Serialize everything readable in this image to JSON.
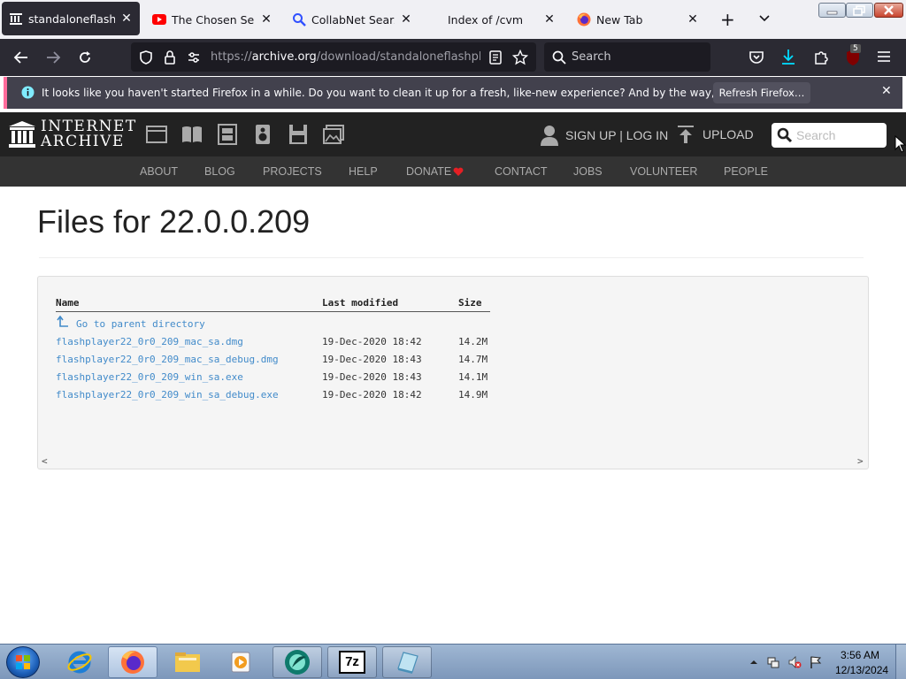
{
  "browser": {
    "tabs": [
      {
        "title": "standaloneflashpla",
        "icon": "internet-archive-favicon",
        "active": true
      },
      {
        "title": "The Chosen Season",
        "icon": "youtube-favicon",
        "active": false
      },
      {
        "title": "CollabNet SearXNG",
        "icon": "searxng-favicon",
        "active": false
      },
      {
        "title": "Index of /cvm",
        "icon": "none",
        "active": false
      },
      {
        "title": "New Tab",
        "icon": "firefox-favicon",
        "active": false
      }
    ],
    "new_tab_label": "+",
    "url_prefix": "https://",
    "url_domain": "archive.org",
    "url_path": "/download/standaloneflashplayer",
    "search_placeholder": "Search",
    "extension_badge": "5"
  },
  "notification": {
    "message": "It looks like you haven't started Firefox in a while. Do you want to clean it up for a fresh, like-new experience? And by the way, welcome back!",
    "button_label": "Refresh Firefox…",
    "close_glyph": "✕"
  },
  "ia_header": {
    "logo_line1": "INTERNET",
    "logo_line2": "ARCHIVE",
    "signup_login": "SIGN UP | LOG IN",
    "upload": "UPLOAD",
    "search_placeholder": "Search"
  },
  "ia_subnav": [
    "ABOUT",
    "BLOG",
    "PROJECTS",
    "HELP",
    "DONATE",
    "CONTACT",
    "JOBS",
    "VOLUNTEER",
    "PEOPLE"
  ],
  "page": {
    "title": "Files for 22.0.0.209",
    "columns": {
      "name": "Name",
      "modified": "Last modified",
      "size": "Size"
    },
    "parent_link": "Go to parent directory",
    "files": [
      {
        "name": "flashplayer22_0r0_209_mac_sa.dmg",
        "modified": "19-Dec-2020 18:42",
        "size": "14.2M"
      },
      {
        "name": "flashplayer22_0r0_209_mac_sa_debug.dmg",
        "modified": "19-Dec-2020 18:43",
        "size": "14.7M"
      },
      {
        "name": "flashplayer22_0r0_209_win_sa.exe",
        "modified": "19-Dec-2020 18:43",
        "size": "14.1M"
      },
      {
        "name": "flashplayer22_0r0_209_win_sa_debug.exe",
        "modified": "19-Dec-2020 18:42",
        "size": "14.9M"
      }
    ],
    "scroll_left": "<",
    "scroll_right": ">"
  },
  "taskbar": {
    "time": "3:56 AM",
    "date": "12/13/2024",
    "apps": [
      "internet-explorer-icon",
      "firefox-icon",
      "file-explorer-icon",
      "media-player-icon",
      "app-teal-icon",
      "7zip-icon",
      "notepad-icon"
    ],
    "seven_zip_label": "7z"
  },
  "colors": {
    "link": "#428bca",
    "browser_dark": "#2b2a33",
    "ia_header": "#222222",
    "notification_accent": "#ff6b9b"
  }
}
